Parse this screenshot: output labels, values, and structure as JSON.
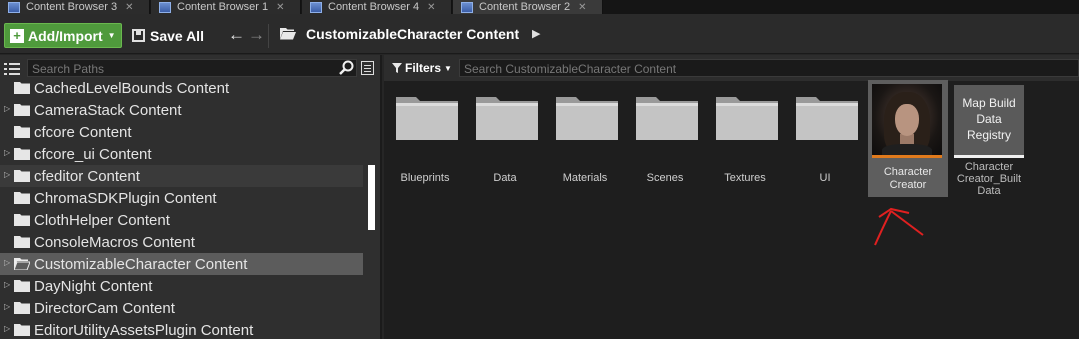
{
  "tabs": [
    {
      "label": "Content Browser 3",
      "active": false
    },
    {
      "label": "Content Browser 1",
      "active": false
    },
    {
      "label": "Content Browser 4",
      "active": false
    },
    {
      "label": "Content Browser 2",
      "active": true
    }
  ],
  "toolbar": {
    "add_import_label": "Add/Import",
    "save_all_label": "Save All",
    "path_label": "CustomizableCharacter Content"
  },
  "left_panel": {
    "search_placeholder": "Search Paths",
    "items": [
      {
        "label": "CachedLevelBounds Content",
        "expandable": false
      },
      {
        "label": "CameraStack Content",
        "expandable": true
      },
      {
        "label": "cfcore Content",
        "expandable": false
      },
      {
        "label": "cfcore_ui Content",
        "expandable": true
      },
      {
        "label": "cfeditor Content",
        "expandable": true
      },
      {
        "label": "ChromaSDKPlugin Content",
        "expandable": false
      },
      {
        "label": "ClothHelper Content",
        "expandable": false
      },
      {
        "label": "ConsoleMacros Content",
        "expandable": false
      },
      {
        "label": "CustomizableCharacter Content",
        "expandable": true
      },
      {
        "label": "DayNight Content",
        "expandable": true
      },
      {
        "label": "DirectorCam Content",
        "expandable": true
      },
      {
        "label": "EditorUtilityAssetsPlugin Content",
        "expandable": true
      }
    ]
  },
  "right_panel": {
    "filters_label": "Filters",
    "search_placeholder": "Search CustomizableCharacter Content",
    "folders": [
      "Blueprints",
      "Data",
      "Materials",
      "Scenes",
      "Textures",
      "UI"
    ],
    "assets": {
      "character_creator": {
        "line1": "Character",
        "line2": "Creator"
      },
      "map_build": {
        "thumb1": "Map Build",
        "thumb2": "Data",
        "thumb3": "Registry",
        "line1": "Character",
        "line2": "Creator_Built",
        "line3": "Data"
      }
    }
  },
  "colors": {
    "add_button": "#4f9a3c",
    "selected_row": "#5c5c5c",
    "asset_stripe": "#e07a1c",
    "annotation_arrow": "#e02020"
  }
}
